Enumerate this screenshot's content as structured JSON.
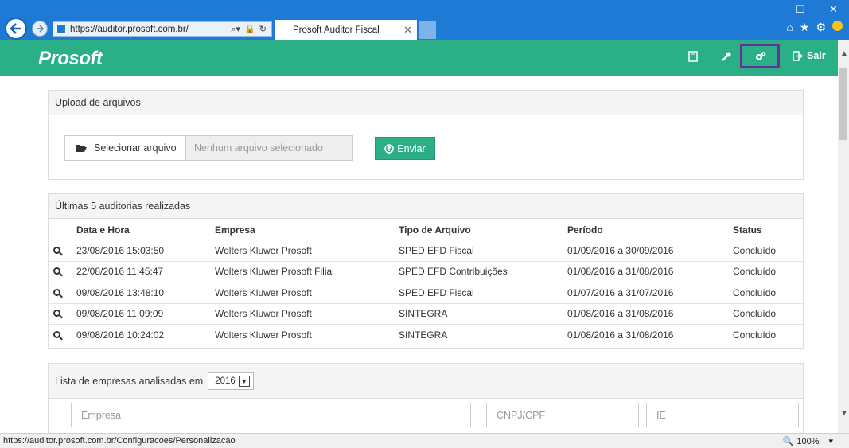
{
  "browser": {
    "url": "https://auditor.prosoft.com.br/",
    "tab_title": "Prosoft Auditor Fiscal",
    "status_url": "https://auditor.prosoft.com.br/Configuracoes/Personalizacao",
    "zoom": "100%"
  },
  "header": {
    "logo": "Prosoft",
    "logout_label": "Sair"
  },
  "upload": {
    "title": "Upload de arquivos",
    "select_label": "Selecionar arquivo",
    "no_file": "Nenhum arquivo selecionado",
    "send_label": "Enviar"
  },
  "audits": {
    "title": "Últimas 5 auditorias realizadas",
    "columns": [
      "Data e Hora",
      "Empresa",
      "Tipo de Arquivo",
      "Período",
      "Status"
    ],
    "rows": [
      [
        "23/08/2016 15:03:50",
        "Wolters Kluwer Prosoft",
        "SPED EFD Fiscal",
        "01/09/2016 a 30/09/2016",
        "Concluído"
      ],
      [
        "22/08/2016 11:45:47",
        "Wolters Kluwer Prosoft Filial",
        "SPED EFD Contribuições",
        "01/08/2016 a 31/08/2016",
        "Concluído"
      ],
      [
        "09/08/2016 13:48:10",
        "Wolters Kluwer Prosoft",
        "SPED EFD Fiscal",
        "01/07/2016 a 31/07/2016",
        "Concluído"
      ],
      [
        "09/08/2016 11:09:09",
        "Wolters Kluwer Prosoft",
        "SINTEGRA",
        "01/08/2016 a 31/08/2016",
        "Concluído"
      ],
      [
        "09/08/2016 10:24:02",
        "Wolters Kluwer Prosoft",
        "SINTEGRA",
        "01/08/2016 a 31/08/2016",
        "Concluído"
      ]
    ]
  },
  "empresas": {
    "title": "Lista de empresas analisadas em",
    "year": "2016",
    "filters": {
      "empresa": "Empresa",
      "cnpj": "CNPJ/CPF",
      "ie": "IE"
    }
  },
  "colors": {
    "brand": "#2aaf87",
    "browser_blue": "#1f7ad6",
    "highlight": "#6a2f9e"
  }
}
